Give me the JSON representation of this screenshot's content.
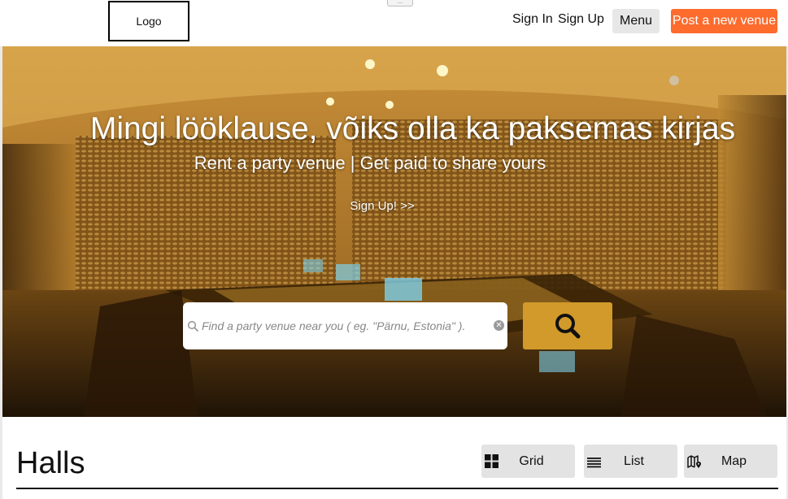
{
  "header": {
    "logo_label": "Logo",
    "dots_label": "...",
    "sign_in": "Sign In",
    "sign_up": "Sign Up",
    "menu": "Menu",
    "post_venue": "Post a new venue"
  },
  "hero": {
    "title": "Mingi lööklause, võiks olla ka paksemas kirjas",
    "subtitle": "Rent a party venue | Get paid to share yours",
    "signup_link": "Sign Up! >>",
    "search": {
      "placeholder": "Find a party venue near you ( eg. \"Pärnu, Estonia\" ).",
      "value": "",
      "clear_icon": "clear-icon",
      "button_icon": "search-icon"
    }
  },
  "halls": {
    "title": "Halls",
    "views": [
      {
        "label": "Grid",
        "icon": "grid-icon"
      },
      {
        "label": "List",
        "icon": "list-icon"
      },
      {
        "label": "Map",
        "icon": "map-icon"
      }
    ]
  },
  "colors": {
    "accent": "#fd6b2d",
    "search_button": "#d19a2a",
    "button_bg": "#e3e3e3"
  }
}
